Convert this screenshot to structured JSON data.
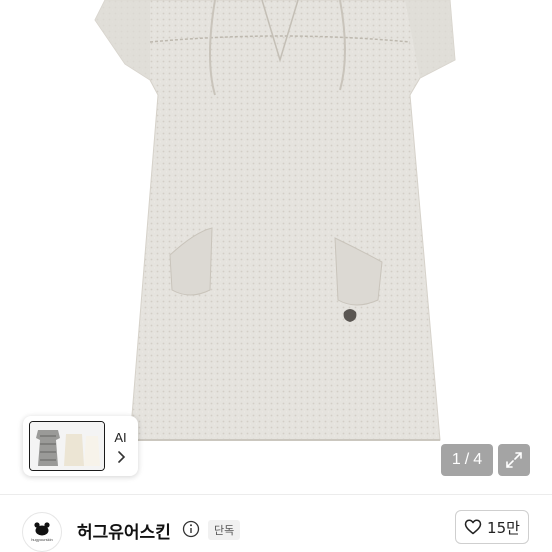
{
  "ai_panel": {
    "label": "AI",
    "thumb_icon": "outfit-thumbnail",
    "chevron_icon": "chevron-right-icon"
  },
  "gallery": {
    "current": "1",
    "separator": "/",
    "total": "4",
    "expand_icon": "expand-icon"
  },
  "brand": {
    "name": "허그유어스킨",
    "logo_text": "hugyourskin",
    "info_icon": "info-icon",
    "badge": "단독"
  },
  "like": {
    "count": "15만",
    "icon": "heart-outline-icon"
  },
  "colors": {
    "dress": "#e4e2dd",
    "dress_shade": "#cfcbc3",
    "overlay": "#5a5a5a",
    "text": "#111111"
  }
}
